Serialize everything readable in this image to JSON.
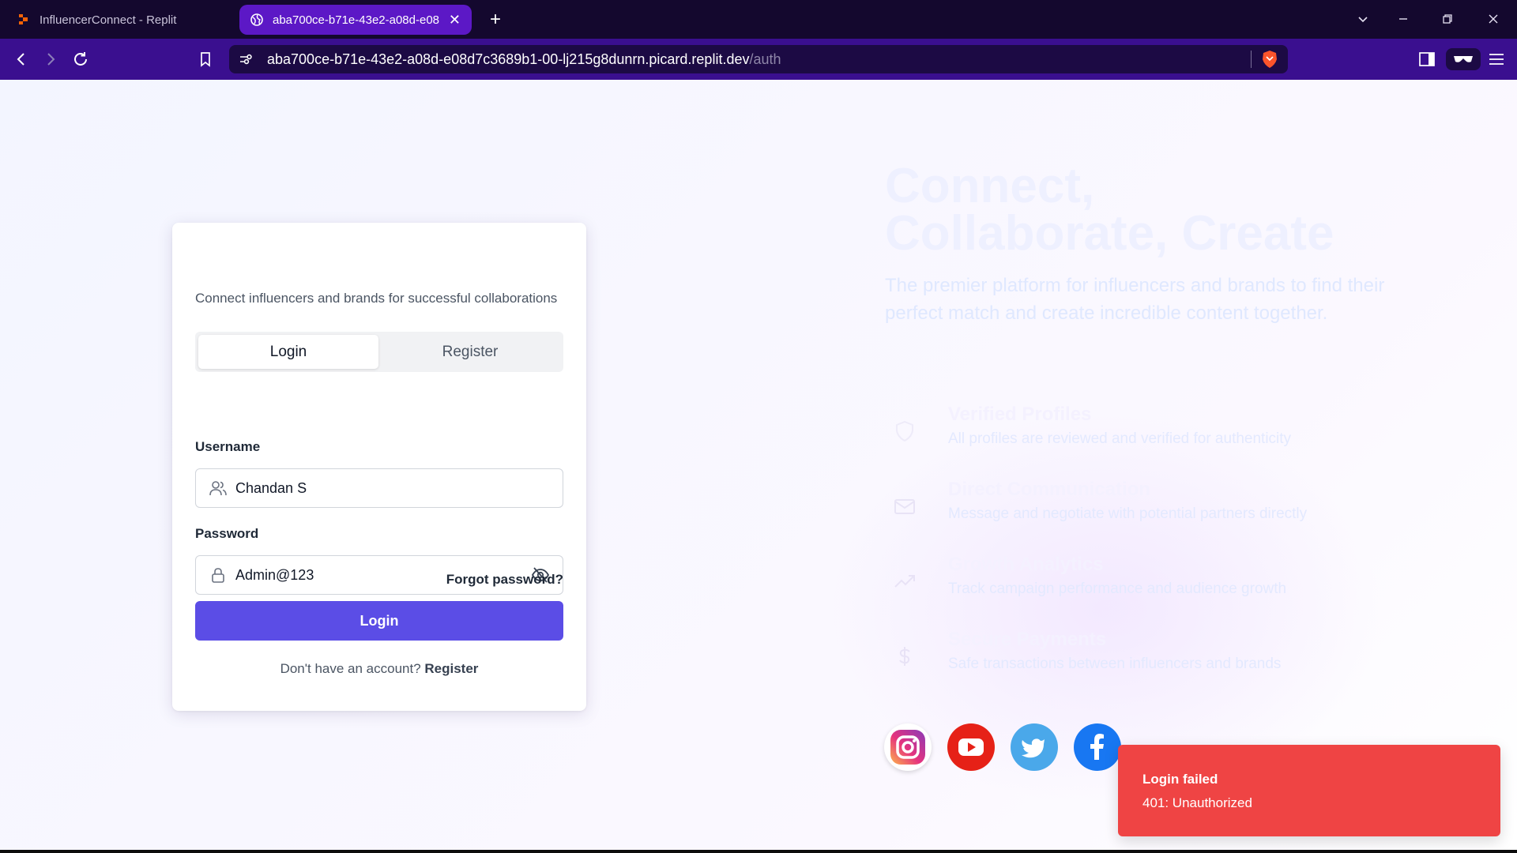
{
  "browser": {
    "tabs": [
      {
        "title": "InfluencerConnect - Replit",
        "active": false
      },
      {
        "title": "aba700ce-b71e-43e2-a08d-e08",
        "active": true
      }
    ],
    "new_tab": "+",
    "address": {
      "host": "aba700ce-b71e-43e2-a08d-e08d7c3689b1-00-lj215g8dunrn.picard.replit.dev",
      "path": "/auth"
    }
  },
  "auth_card": {
    "subtitle": "Connect influencers and brands for successful collaborations",
    "tabs": {
      "login": "Login",
      "register": "Register"
    },
    "username": {
      "label": "Username",
      "value": "Chandan S"
    },
    "password": {
      "label": "Password",
      "value": "Admin@123"
    },
    "forgot": "Forgot password?",
    "submit": "Login",
    "signup_prompt": "Don't have an account?",
    "signup_link": "Register"
  },
  "hero": {
    "title": "Connect, Collaborate, Create",
    "subtitle": "The premier platform for influencers and brands to find their perfect match and create incredible content together.",
    "features": [
      {
        "title": "Verified Profiles",
        "desc": "All profiles are reviewed and verified for authenticity",
        "icon": "shield-icon"
      },
      {
        "title": "Direct Communication",
        "desc": "Message and negotiate with potential partners directly",
        "icon": "mail-icon"
      },
      {
        "title": "Growth Analytics",
        "desc": "Track campaign performance and audience growth",
        "icon": "trending-icon"
      },
      {
        "title": "Secure Payments",
        "desc": "Safe transactions between influencers and brands",
        "icon": "dollar-icon"
      }
    ]
  },
  "social": [
    "instagram-icon",
    "youtube-icon",
    "twitter-icon",
    "facebook-icon"
  ],
  "toast": {
    "title": "Login failed",
    "message": "401: Unauthorized"
  },
  "colors": {
    "primary": "#5b4de6",
    "toast": "#ef4444",
    "tab_active": "#5c18c6",
    "toolbar": "#3a0f8f",
    "tabstrip": "#14082e"
  }
}
